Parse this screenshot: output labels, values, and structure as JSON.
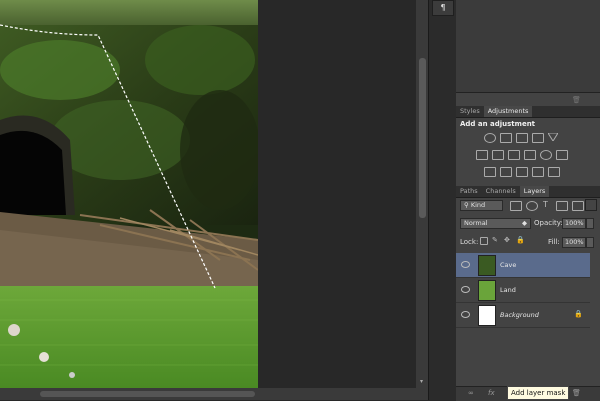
{
  "panels": {
    "top_tabs": [
      "Styles",
      "Adjustments"
    ],
    "active_top_tab": "Adjustments",
    "adjustments_title": "Add an adjustment",
    "layer_tabs": [
      "Paths",
      "Channels",
      "Layers"
    ],
    "active_layer_tab": "Layers",
    "filter_kind": "Kind",
    "blend_mode": "Normal",
    "opacity_label": "Opacity:",
    "opacity_value": "100%",
    "lock_label": "Lock:",
    "fill_label": "Fill:",
    "fill_value": "100%"
  },
  "layers": [
    {
      "name": "Cave",
      "selected": true
    },
    {
      "name": "Land",
      "selected": false
    },
    {
      "name": "Background",
      "selected": false,
      "locked": true
    }
  ],
  "footer": {
    "link_icon": "link-icon",
    "fx_label": "fx"
  },
  "tooltip": "Add layer mask",
  "colors": {
    "panel_bg": "#434343",
    "selected_layer": "#5a6b8c",
    "tooltip_bg": "#fffbe0"
  }
}
